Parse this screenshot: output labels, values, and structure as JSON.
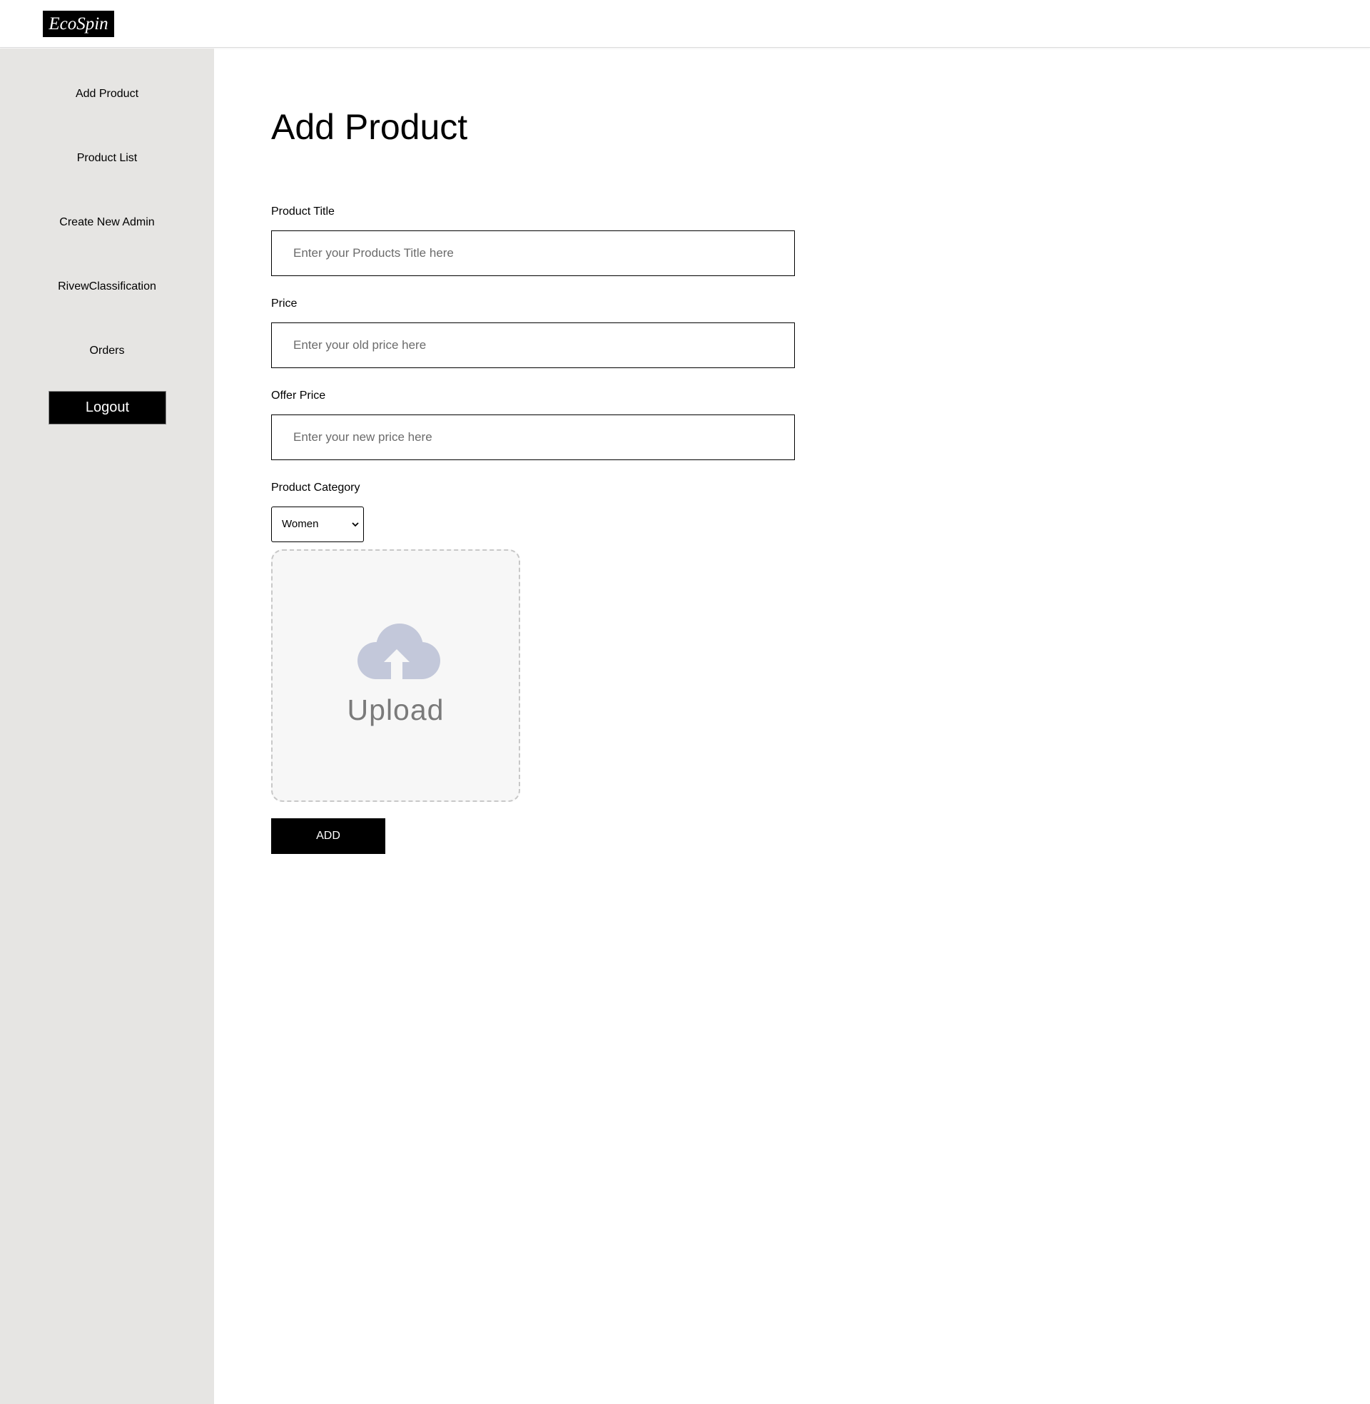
{
  "brand": {
    "logo_text": "EcoSpin"
  },
  "sidebar": {
    "items": [
      {
        "label": "Add Product"
      },
      {
        "label": "Product List"
      },
      {
        "label": "Create New Admin"
      },
      {
        "label": "RivewClassification"
      },
      {
        "label": "Orders"
      }
    ],
    "logout_label": "Logout"
  },
  "main": {
    "title": "Add Product",
    "form": {
      "product_title": {
        "label": "Product Title",
        "value": "",
        "placeholder": "Enter your Products Title here"
      },
      "price": {
        "label": "Price",
        "value": "",
        "placeholder": "Enter your old price here"
      },
      "offer_price": {
        "label": "Offer Price",
        "value": "",
        "placeholder": "Enter your new price here"
      },
      "category": {
        "label": "Product Category",
        "selected": "Women"
      },
      "upload": {
        "label": "Upload",
        "icon": "cloud-upload-icon",
        "icon_color": "#c3c8da"
      },
      "submit_label": "ADD"
    }
  },
  "colors": {
    "sidebar_bg": "#e6e5e3",
    "button_bg": "#000000",
    "button_text": "#ffffff"
  }
}
